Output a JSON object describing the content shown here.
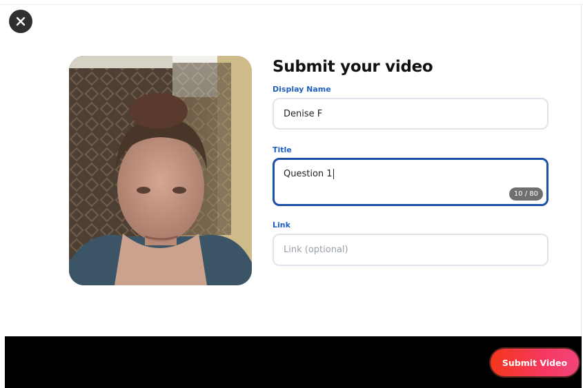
{
  "modal": {
    "title": "Submit your video",
    "close_icon": "close-icon"
  },
  "preview": {
    "icon": "webcam-preview"
  },
  "fields": {
    "display_name": {
      "label": "Display Name",
      "value": "Denise F"
    },
    "title": {
      "label": "Title",
      "value": "Question 1",
      "counter": "10 / 80"
    },
    "link": {
      "label": "Link",
      "value": "",
      "placeholder": "Link (optional)"
    }
  },
  "footer": {
    "submit_label": "Submit Video"
  },
  "colors": {
    "label_blue": "#1f5fbf",
    "focus_border": "#1a4fa8",
    "submit_gradient_start": "#f4371d",
    "submit_gradient_end": "#f0457b",
    "footer_bg": "#000000"
  }
}
